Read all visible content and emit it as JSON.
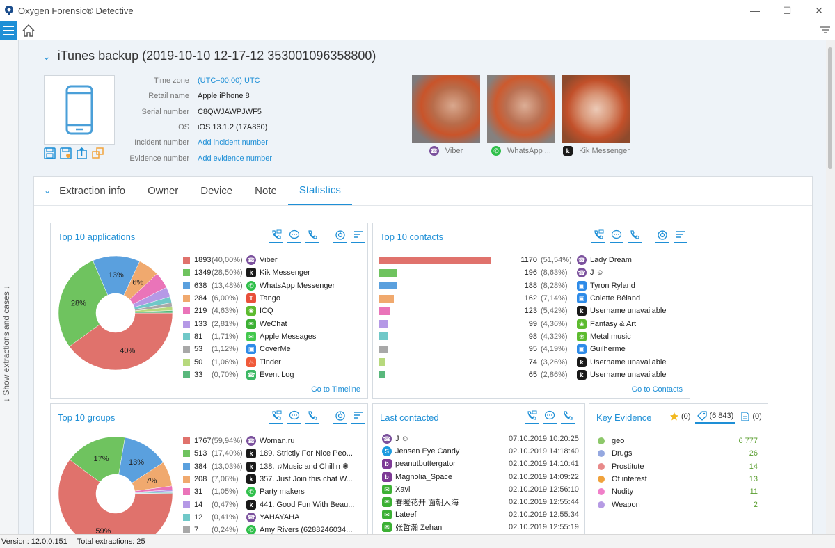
{
  "window": {
    "title": "Oxygen Forensic® Detective",
    "buttons": [
      "minimize",
      "maximize",
      "close"
    ]
  },
  "sidepanel": {
    "label": "↓ Show extractions and cases ↓"
  },
  "device": {
    "title": "iTunes backup (2019-10-10 12-17-12 353001096358800)",
    "properties": [
      {
        "label": "Time zone",
        "value": "(UTC+00:00) UTC",
        "link": true
      },
      {
        "label": "Retail name",
        "value": "Apple iPhone 8",
        "link": false
      },
      {
        "label": "Serial number",
        "value": "C8QWJAWPJWF5",
        "link": false
      },
      {
        "label": "OS",
        "value": "iOS 13.1.2 (17A860)",
        "link": false
      },
      {
        "label": "Incident number",
        "value": "Add incident number",
        "link": true
      },
      {
        "label": "Evidence number",
        "value": "Add evidence number",
        "link": true
      }
    ],
    "photos": [
      {
        "caption": "Viber",
        "icon": "viber-icon"
      },
      {
        "caption": "WhatsApp ...",
        "icon": "whatsapp-icon"
      },
      {
        "caption": "Kik Messenger",
        "icon": "kik-icon"
      }
    ]
  },
  "tabs": [
    "Extraction info",
    "Owner",
    "Device",
    "Note",
    "Statistics"
  ],
  "active_tab": "Statistics",
  "colors": {
    "accent": "#1e8fd6",
    "palette": [
      "#e0726c",
      "#6fc35f",
      "#5aa0de",
      "#f0a96e",
      "#ea74b9",
      "#b599e6",
      "#70c8c8",
      "#a8a8a8",
      "#b7d97d",
      "#59b87c"
    ]
  },
  "top_apps": {
    "title": "Top 10 applications",
    "link": "Go to Timeline",
    "items": [
      {
        "count": "1893",
        "pct": "(40,00%)",
        "name": "Viber",
        "icon": "viber-icon",
        "value": 40.0
      },
      {
        "count": "1349",
        "pct": "(28,50%)",
        "name": "Kik Messenger",
        "icon": "kik-icon",
        "value": 28.5
      },
      {
        "count": "638",
        "pct": "(13,48%)",
        "name": "WhatsApp Messenger",
        "icon": "whatsapp-icon",
        "value": 13.48
      },
      {
        "count": "284",
        "pct": "(6,00%)",
        "name": "Tango",
        "icon": "tango-icon",
        "value": 6.0
      },
      {
        "count": "219",
        "pct": "(4,63%)",
        "name": "ICQ",
        "icon": "icq-icon",
        "value": 4.63
      },
      {
        "count": "133",
        "pct": "(2,81%)",
        "name": "WeChat",
        "icon": "wechat-icon",
        "value": 2.81
      },
      {
        "count": "81",
        "pct": "(1,71%)",
        "name": "Apple Messages",
        "icon": "apple-messages-icon",
        "value": 1.71
      },
      {
        "count": "53",
        "pct": "(1,12%)",
        "name": "CoverMe",
        "icon": "coverme-icon",
        "value": 1.12
      },
      {
        "count": "50",
        "pct": "(1,06%)",
        "name": "Tinder",
        "icon": "tinder-icon",
        "value": 1.06
      },
      {
        "count": "33",
        "pct": "(0,70%)",
        "name": "Event Log",
        "icon": "event-log-icon",
        "value": 0.7
      }
    ],
    "pie_labels": [
      "40%",
      "28%",
      "13%",
      "6%"
    ]
  },
  "top_contacts": {
    "title": "Top 10 contacts",
    "link": "Go to Contacts",
    "items": [
      {
        "count": "1170",
        "pct": "(51,54%)",
        "name": "Lady Dream",
        "icon": "viber-icon",
        "value": 51.54
      },
      {
        "count": "196",
        "pct": "(8,63%)",
        "name": "J ☺",
        "icon": "viber-icon",
        "value": 8.63
      },
      {
        "count": "188",
        "pct": "(8,28%)",
        "name": "Tyron Ryland",
        "icon": "coverme-icon",
        "value": 8.28
      },
      {
        "count": "162",
        "pct": "(7,14%)",
        "name": "Colette Béland",
        "icon": "coverme-icon",
        "value": 7.14
      },
      {
        "count": "123",
        "pct": "(5,42%)",
        "name": "Username unavailable",
        "icon": "kik-icon",
        "value": 5.42
      },
      {
        "count": "99",
        "pct": "(4,36%)",
        "name": "Fantasy & Art",
        "icon": "icq-icon",
        "value": 4.36
      },
      {
        "count": "98",
        "pct": "(4,32%)",
        "name": "Metal music",
        "icon": "icq-icon",
        "value": 4.32
      },
      {
        "count": "95",
        "pct": "(4,19%)",
        "name": "Guilherme",
        "icon": "coverme-icon",
        "value": 4.19
      },
      {
        "count": "74",
        "pct": "(3,26%)",
        "name": "Username unavailable",
        "icon": "kik-icon",
        "value": 3.26
      },
      {
        "count": "65",
        "pct": "(2,86%)",
        "name": "Username unavailable",
        "icon": "kik-icon",
        "value": 2.86
      }
    ]
  },
  "top_groups": {
    "title": "Top 10 groups",
    "items": [
      {
        "count": "1767",
        "pct": "(59,94%)",
        "name": "Woman.ru",
        "icon": "viber-icon",
        "value": 59.94
      },
      {
        "count": "513",
        "pct": "(17,40%)",
        "name": "189. Strictly For Nice Peo...",
        "icon": "kik-icon",
        "value": 17.4
      },
      {
        "count": "384",
        "pct": "(13,03%)",
        "name": "138. ♫Music and Chillin ❃",
        "icon": "kik-icon",
        "value": 13.03
      },
      {
        "count": "208",
        "pct": "(7,06%)",
        "name": "357. Just Join this chat W...",
        "icon": "kik-icon",
        "value": 7.06
      },
      {
        "count": "31",
        "pct": "(1,05%)",
        "name": "Party makers",
        "icon": "whatsapp-icon",
        "value": 1.05
      },
      {
        "count": "14",
        "pct": "(0,47%)",
        "name": "441. Good Fun With Beau...",
        "icon": "kik-icon",
        "value": 0.47
      },
      {
        "count": "12",
        "pct": "(0,41%)",
        "name": "YAHAYAHA",
        "icon": "viber-icon",
        "value": 0.41
      },
      {
        "count": "7",
        "pct": "(0,24%)",
        "name": "Amy Rivers (6288246034...",
        "icon": "whatsapp-icon",
        "value": 0.24
      }
    ],
    "pie_labels": [
      "59%",
      "17%",
      "13%",
      "7%"
    ]
  },
  "last_contacted": {
    "title": "Last contacted",
    "items": [
      {
        "name": "J ☺",
        "time": "07.10.2019 10:20:25",
        "icon": "viber-icon"
      },
      {
        "name": "Jensen Eye Candy",
        "time": "02.10.2019 14:18:40",
        "icon": "skype-icon"
      },
      {
        "name": "peanutbuttergator",
        "time": "02.10.2019 14:10:41",
        "icon": "badoo-icon"
      },
      {
        "name": "Magnolia_Space",
        "time": "02.10.2019 14:09:22",
        "icon": "badoo-icon"
      },
      {
        "name": "Xavi",
        "time": "02.10.2019 12:56:10",
        "icon": "wechat-icon"
      },
      {
        "name": "春暖花开 面朝大海",
        "time": "02.10.2019 12:55:44",
        "icon": "wechat-icon"
      },
      {
        "name": "Lateef",
        "time": "02.10.2019 12:55:34",
        "icon": "wechat-icon"
      },
      {
        "name": "张哲瀚 Zehan",
        "time": "02.10.2019 12:55:19",
        "icon": "wechat-icon"
      }
    ]
  },
  "key_evidence": {
    "title": "Key Evidence",
    "heads": [
      {
        "icon": "star-icon",
        "text": "(0)"
      },
      {
        "icon": "tag-icon",
        "text": "(6 843)"
      },
      {
        "icon": "note-icon",
        "text": "(0)"
      }
    ],
    "items": [
      {
        "name": "geo",
        "value": "6 777",
        "color": "#8dc86a"
      },
      {
        "name": "Drugs",
        "value": "26",
        "color": "#95a8e0"
      },
      {
        "name": "Prostitute",
        "value": "14",
        "color": "#e88a8a"
      },
      {
        "name": "Of interest",
        "value": "13",
        "color": "#f0a23c"
      },
      {
        "name": "Nudity",
        "value": "11",
        "color": "#f07fc9"
      },
      {
        "name": "Weapon",
        "value": "2",
        "color": "#b69be4"
      }
    ]
  },
  "status": {
    "version": "Version: 12.0.0.151",
    "extractions": "Total extractions: 25"
  }
}
